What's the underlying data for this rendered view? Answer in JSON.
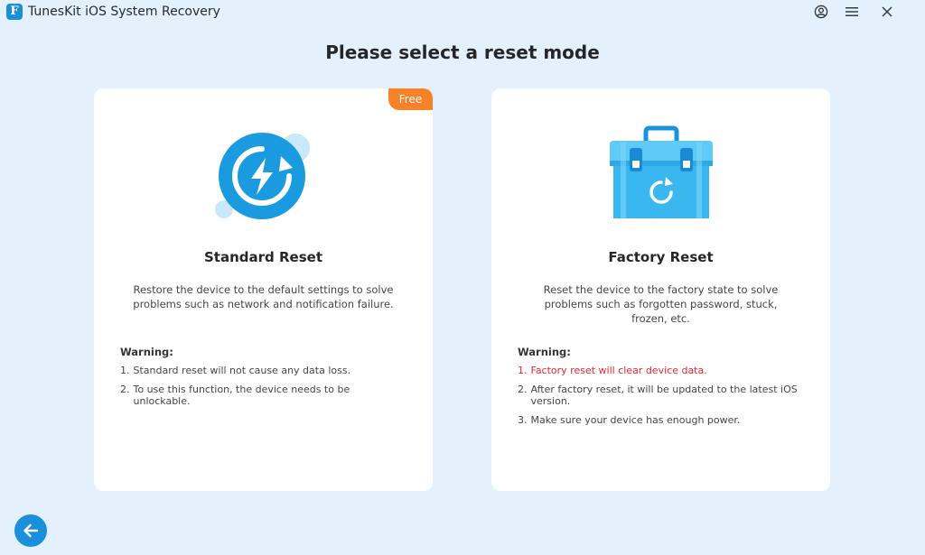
{
  "window": {
    "title": "TunesKit iOS System Recovery",
    "logo_letter": "F",
    "controls": {
      "account_icon": "account-icon",
      "menu_icon": "menu-icon",
      "close_icon": "close-icon"
    }
  },
  "page": {
    "title": "Please select a reset mode"
  },
  "cards": {
    "standard": {
      "badge": "Free",
      "icon": "refresh-lightning-icon",
      "title": "Standard Reset",
      "description": "Restore the device to the default settings to solve problems such as network and notification failure.",
      "warning_title": "Warning:",
      "warnings": [
        {
          "num": "1.",
          "text": "Standard reset will not cause any data loss."
        },
        {
          "num": "2.",
          "text": "To use this function, the device needs to be unlockable."
        }
      ]
    },
    "factory": {
      "icon": "toolbox-refresh-icon",
      "title": "Factory Reset",
      "description": "Reset the device to the factory state to solve problems such as forgotten password, stuck, frozen, etc.",
      "warning_title": "Warning:",
      "warnings": [
        {
          "num": "1.",
          "text": "Factory reset will clear device data."
        },
        {
          "num": "2.",
          "text": "After factory reset, it will be updated to the latest iOS version."
        },
        {
          "num": "3.",
          "text": "Make sure your device has enough power."
        }
      ]
    }
  },
  "footer": {
    "back_icon": "arrow-left-icon"
  },
  "colors": {
    "background": "#e2f1fb",
    "accent": "#1a8fdb",
    "badge": "#f78227",
    "danger": "#e8262b"
  }
}
